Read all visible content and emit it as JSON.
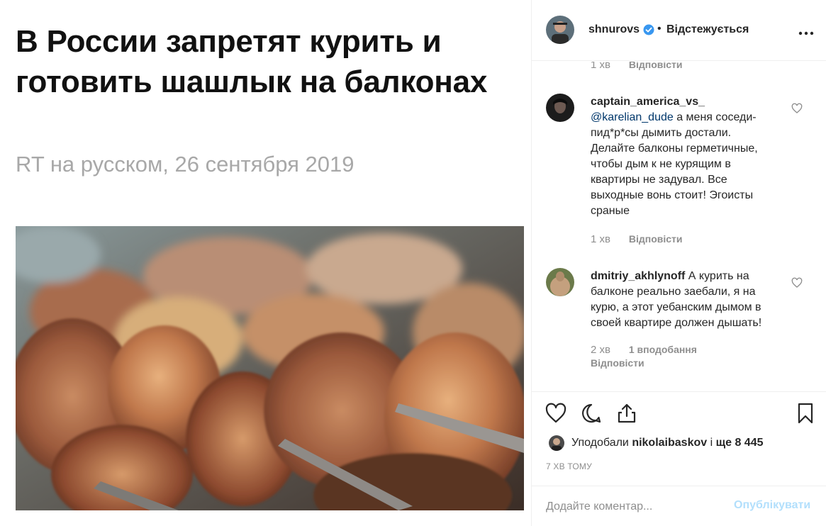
{
  "post_image": {
    "headline": "В России запретят курить и готовить шашлык на балконах",
    "source": "RT на русском, 26 сентября 2019"
  },
  "header": {
    "username": "shnurovs",
    "separator": "•",
    "follow_state": "Відстежується",
    "icons": {
      "verified": "verified-badge-icon",
      "more": "more-options-icon"
    }
  },
  "comments": {
    "top_partial": {
      "time": "1 хв",
      "reply": "Відповісти"
    },
    "items": [
      {
        "username": "captain_america_vs_",
        "mention": "@karelian_dude",
        "text": " а меня соседи-пид*р*сы дымить достали. Делайте балконы герметичные, чтобы дым к не курящим в квартиры не задувал. Все выходные вонь стоит! Эгоисты сраные",
        "time": "1 хв",
        "likes": "",
        "reply": "Відповісти"
      },
      {
        "username": "dmitriy_akhlynoff",
        "mention": "",
        "text": " А курить на балконе реально заебали, я на курю, а этот уебанским дымом в своей квартире должен дышать!",
        "time": "2 хв",
        "likes": "1 вподобання",
        "reply": "Відповісти"
      }
    ]
  },
  "actions": {
    "icons": [
      "heart-icon",
      "comment-icon",
      "share-icon",
      "bookmark-icon"
    ]
  },
  "likes": {
    "prefix": "Уподобали",
    "user": "nikolaibaskov",
    "conj": "і",
    "more": "ще 8 445"
  },
  "timestamp": "7 хв тому",
  "add_comment": {
    "placeholder": "Додайте коментар...",
    "post_label": "Опублікувати"
  },
  "colors": {
    "text": "#262626",
    "muted": "#8e8e8e",
    "mention": "#00376b",
    "post_disabled": "#b2dffc",
    "verified": "#3897f0"
  }
}
